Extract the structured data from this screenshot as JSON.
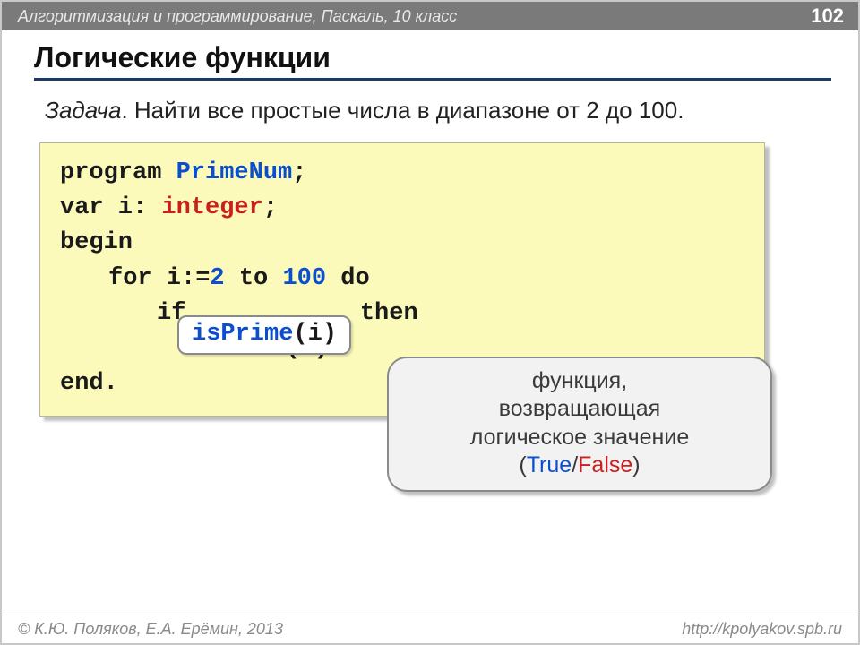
{
  "header": {
    "course": "Алгоритмизация и программирование, Паскаль, 10 класс",
    "page": "102"
  },
  "title": "Логические функции",
  "task": {
    "label": "Задача",
    "text": ". Найти все простые числа в диапазоне от 2 до 100."
  },
  "code": {
    "l1a": "program ",
    "l1b": "PrimeNum",
    "l1c": ";",
    "l2a": "var i: ",
    "l2b": "integer",
    "l2c": ";",
    "l3": "begin",
    "l4a": "for i:=",
    "l4b": "2",
    "l4c": " to ",
    "l4d": "100",
    "l4e": " do",
    "l5a": "if ",
    "l5c": " then",
    "l6": "writeln(i)",
    "l7": "end."
  },
  "callout": {
    "func": "isPrime",
    "args": "(i)"
  },
  "bubble": {
    "line1": "функция,",
    "line2": "возвращающая",
    "line3": "логическое значение",
    "paren_open": "(",
    "true": "True",
    "slash": "/",
    "false": "False",
    "paren_close": ")"
  },
  "footer": {
    "copyright": "© К.Ю. Поляков, Е.А. Ерёмин, 2013",
    "url": "http://kpolyakov.spb.ru"
  }
}
